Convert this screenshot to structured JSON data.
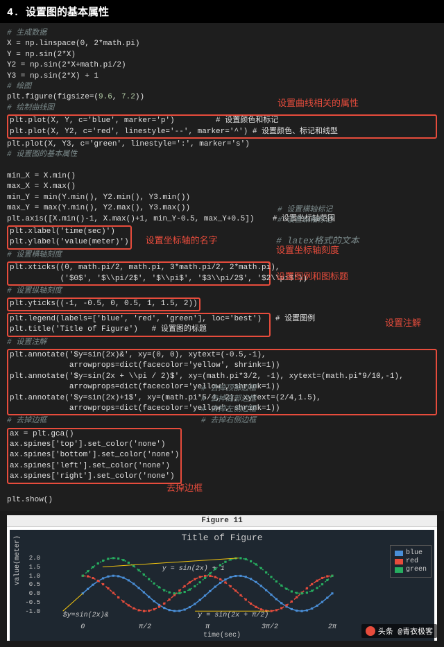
{
  "header": "4. 设置图的基本属性",
  "code": {
    "c1": "# 生成数据",
    "l1": "X = np.linspace(0, 2*math.pi)",
    "l2": "Y = np.sin(2*X)",
    "l3": "Y2 = np.sin(2*X+math.pi/2)",
    "l4": "Y3 = np.sin(2*X) + 1",
    "c2": "# 绘图",
    "l5a": "plt.figure(figsize=(",
    "l5b": "9.6",
    "l5c": ", ",
    "l5d": "7.2",
    "l5e": "))",
    "c3": "# 绘制曲线图",
    "l6": "plt.plot(X, Y, c='blue', marker='p')         # 设置颜色和标记",
    "l7": "plt.plot(X, Y2, c='red', linestyle='--', marker='^') # 设置颜色、标记和线型",
    "l8": "plt.plot(X, Y3, c='green', linestyle=':', marker='s')",
    "c4": "# 设置图的基本属性",
    "l9": "min_X = X.min()",
    "l10": "max_X = X.max()",
    "l11": "min_Y = min(Y.min(), Y2.min(), Y3.min())",
    "l12": "max_Y = max(Y.min(), Y2.max(), Y3.max())",
    "l13": "plt.axis([X.min()-1, X.max()+1, min_Y-0.5, max_Y+0.5])    # 设置坐标轴范围",
    "l14": "plt.xlabel('time(sec)')",
    "l14c": "# 设置横轴标记",
    "l15": "plt.ylabel('value(meter)')",
    "l15c": "# 设置纵轴标记",
    "c5": "# 设置横轴刻度",
    "l16": "plt.xticks((0, math.pi/2, math.pi, 3*math.pi/2, 2*math.pi),",
    "l17": "           ('$0$', '$\\\\pi/2$', '$\\\\pi$', '$3\\\\pi/2$', '$2\\\\pi$'))",
    "l17c": "# latex格式的文本",
    "c6": "# 设置纵轴刻度",
    "l18": "plt.yticks((-1, -0.5, 0, 0.5, 1, 1.5, 2))",
    "l19": "plt.legend(labels=['blue', 'red', 'green'], loc='best')   # 设置图例",
    "l20": "plt.title('Title of Figure')   # 设置图的标题",
    "c7": "# 设置注解",
    "l21": "plt.annotate('$y=sin(2x)&', xy=(0, 0), xytext=(-0.5,-1),",
    "l22": "             arrowprops=dict(facecolor='yellow', shrink=1))",
    "l23": "plt.annotate('$y=sin(2x + \\\\pi / 2)$', xy=(math.pi*3/2, -1), xytext=(math.pi*9/10,-1),",
    "l24": "             arrowprops=dict(facecolor='yellow', shrink=1))",
    "l25": "plt.annotate('$y=sin(2x)+1$', xy=(math.pi*5/4, 2), xytext=(2/4,1.5),",
    "l26": "             arrowprops=dict(facecolor='yellow', shrink=1))",
    "c8": "# 去掉边框",
    "l27": "ax = plt.gca()",
    "l28": "ax.spines['top'].set_color('none')",
    "l28c": "# 去掉顶部边框",
    "l29": "ax.spines['bottom'].set_color('none')",
    "l29c": "# 去掉底部边框",
    "l30": "ax.spines['left'].set_color('none')",
    "l30c": "# 去掉左侧边框",
    "l31": "ax.spines['right'].set_color('none')",
    "l31c": "# 去掉右侧边框",
    "l32": "plt.show()"
  },
  "annotations": {
    "a1": "设置曲线相关的属性",
    "a2": "设置坐标轴的名字",
    "a3": "设置坐标轴刻度",
    "a4": "设置图例和图标题",
    "a5": "设置注解",
    "a6": "去掉边框"
  },
  "figure": {
    "window_title": "Figure 11",
    "title": "Title of Figure",
    "xlabel": "time(sec)",
    "ylabel": "value(meter)",
    "legend": [
      "blue",
      "red",
      "green"
    ],
    "ann1": "y = sin(2x) + 1",
    "ann2": "$y=sin(2x)&",
    "ann3": "y = sin(2x + π/2)",
    "xticks": [
      "0",
      "π/2",
      "π",
      "3π/2",
      "2π"
    ],
    "yticks": [
      "-1.0",
      "-0.5",
      "0.0",
      "0.5",
      "1.0",
      "1.5",
      "2.0"
    ]
  },
  "attribution": "头条 @青衣极客",
  "chart_data": {
    "type": "line",
    "title": "Title of Figure",
    "xlabel": "time(sec)",
    "ylabel": "value(meter)",
    "x": [
      0,
      0.1283,
      0.2566,
      0.3849,
      0.5132,
      0.6415,
      0.7698,
      0.8981,
      1.0264,
      1.1547,
      1.283,
      1.4113,
      1.5396,
      1.6679,
      1.7962,
      1.9245,
      2.0528,
      2.1811,
      2.3094,
      2.4377,
      2.566,
      2.6943,
      2.8226,
      2.9509,
      3.0792,
      3.2075,
      3.3358,
      3.4641,
      3.5924,
      3.7207,
      3.849,
      3.9773,
      4.1056,
      4.2339,
      4.3622,
      4.4905,
      4.6188,
      4.7471,
      4.8754,
      5.0037,
      5.132,
      5.2603,
      5.3886,
      5.5169,
      5.6452,
      5.7735,
      5.9018,
      6.0301,
      6.1584,
      6.2832
    ],
    "series": [
      {
        "name": "blue",
        "color": "#4a8fd8",
        "marker": "p",
        "formula": "sin(2x)"
      },
      {
        "name": "red",
        "color": "#e74c3c",
        "marker": "^",
        "linestyle": "--",
        "formula": "sin(2x+π/2)"
      },
      {
        "name": "green",
        "color": "#27ae60",
        "marker": "s",
        "linestyle": ":",
        "formula": "sin(2x)+1"
      }
    ],
    "xticks": [
      0,
      1.5708,
      3.1416,
      4.7124,
      6.2832
    ],
    "xtick_labels": [
      "0",
      "π/2",
      "π",
      "3π/2",
      "2π"
    ],
    "yticks": [
      -1.0,
      -0.5,
      0.0,
      0.5,
      1.0,
      1.5,
      2.0
    ],
    "xlim": [
      -1,
      7.28
    ],
    "ylim": [
      -1.5,
      2.5
    ],
    "annotations": [
      {
        "text": "$y=sin(2x)&",
        "xy": [
          0,
          0
        ],
        "xytext": [
          -0.5,
          -1
        ]
      },
      {
        "text": "y=sin(2x+π/2)",
        "xy": [
          4.712,
          -1
        ],
        "xytext": [
          2.827,
          -1
        ]
      },
      {
        "text": "y=sin(2x)+1",
        "xy": [
          3.927,
          2
        ],
        "xytext": [
          0.5,
          1.5
        ]
      }
    ]
  }
}
